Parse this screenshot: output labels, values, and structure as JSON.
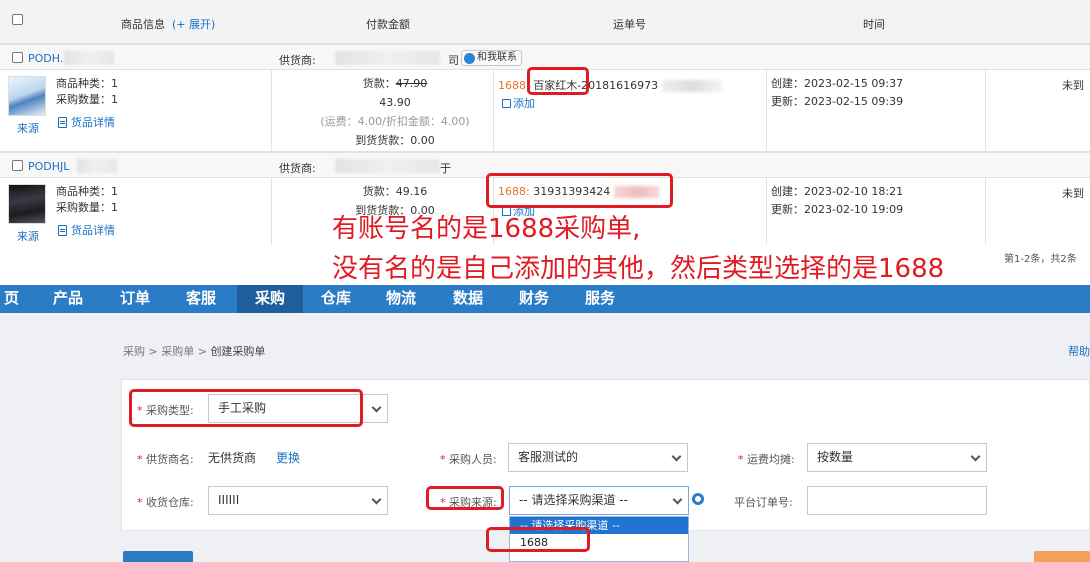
{
  "colors": {
    "accent": "#2b7cc7",
    "annotation_red": "#e01b24",
    "link": "#1a6fc4",
    "channel_orange": "#e8732a"
  },
  "table": {
    "headers": {
      "product": "商品信息",
      "expand": "(+ 展开)",
      "amount": "付款金额",
      "tracking": "运单号",
      "time": "时间"
    },
    "orders": [
      {
        "id": "PODH.",
        "supplier_label": "供货商:",
        "supplier_end": "司",
        "contact_label": "和我联系",
        "kinds": "商品种类：1",
        "qty": "采购数量：1",
        "source": "来源",
        "detail": "货品详情",
        "goods": "货款：",
        "goods_old": "47.90",
        "goods_new": "43.90",
        "freight": "(运费：4.00/折扣金额：4.00)",
        "arrived": "到货货款：0.00",
        "channel": "1688:",
        "account": "百家红木",
        "tracking_no": "-20181616973",
        "add": "添加",
        "created": "创建：2023-02-15 09:37",
        "updated": "更新：2023-02-15 09:39",
        "status": "未到"
      },
      {
        "id": "PODHJL",
        "supplier_label": "供货商:",
        "supplier_end": "于",
        "kinds": "商品种类：1",
        "qty": "采购数量：1",
        "source": "来源",
        "detail": "货品详情",
        "goods": "货款：49.16",
        "arrived": "到货货款：0.00",
        "channel": "1688:",
        "tracking_no": "31931393424",
        "add": "添加",
        "created": "创建：2023-02-10 18:21",
        "updated": "更新：2023-02-10 19:09",
        "status": "未到"
      }
    ],
    "pager": "第1-2条，共2条"
  },
  "annotation": {
    "line1": "有账号名的是1688采购单,",
    "line2": "没有名的是自己添加的其他，然后类型选择的是1688"
  },
  "nav": {
    "items": [
      "页",
      "产品",
      "订单",
      "客服",
      "采购",
      "仓库",
      "物流",
      "数据",
      "财务",
      "服务"
    ]
  },
  "breadcrumb": {
    "a": "采购",
    "b": "采购单",
    "c": "创建采购单",
    "sep": " > "
  },
  "help": "帮助",
  "form": {
    "type_label": "采购类型:",
    "type_value": "手工采购",
    "supplier_label": "供货商名:",
    "supplier_value": "无供货商",
    "supplier_change": "更换",
    "buyer_label": "采购人员:",
    "buyer_value": "客服测试的",
    "freight_label": "运费均摊:",
    "freight_value": "按数量",
    "warehouse_label": "收货仓库:",
    "warehouse_value": "IIIIII",
    "source_label": "采购来源:",
    "source_value": "-- 请选择采购渠道 --",
    "platform_label": "平台订单号:",
    "dropdown_options": [
      "-- 请选择采购渠道 --",
      "1688"
    ]
  }
}
